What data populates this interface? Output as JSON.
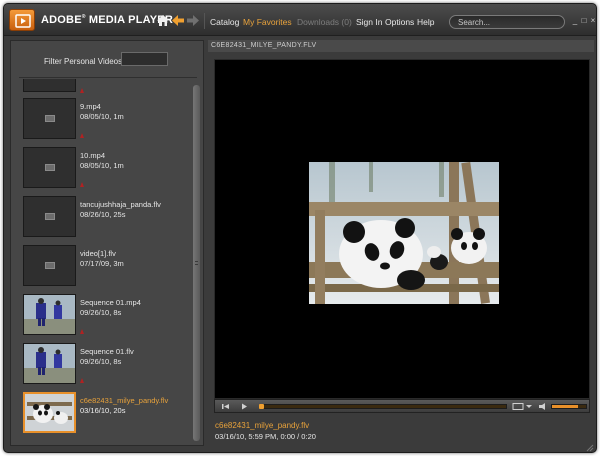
{
  "app": {
    "brand": "ADOBE",
    "brand_mark": "®",
    "brand_suffix": " MEDIA PLAYER"
  },
  "nav": {
    "home_icon": "home-icon",
    "back_icon": "back-arrow-icon",
    "forward_icon": "forward-arrow-icon"
  },
  "menu": {
    "catalog": "Catalog",
    "favorites": "My Favorites",
    "downloads": "Downloads (0)",
    "sign_in": "Sign In",
    "options": "Options",
    "help": "Help"
  },
  "search": {
    "placeholder": "Search..."
  },
  "window_controls": {
    "minimize": "_",
    "maximize": "□",
    "close": "×"
  },
  "sidebar": {
    "filter_label": "Filter Personal Videos",
    "filter_value": "",
    "items": [
      {
        "title": "9.mp4",
        "meta": "08/05/10, 1m",
        "thumb": "placeholder",
        "flag": true
      },
      {
        "title": "10.mp4",
        "meta": "08/05/10, 1m",
        "thumb": "placeholder",
        "flag": true
      },
      {
        "title": "tancujushhaja_panda.flv",
        "meta": "08/26/10, 25s",
        "thumb": "placeholder",
        "flag": false
      },
      {
        "title": "video[1].flv",
        "meta": "07/17/09, 3m",
        "thumb": "placeholder",
        "flag": false
      },
      {
        "title": "Sequence 01.mp4",
        "meta": "09/26/10, 8s",
        "thumb": "sequence",
        "flag": true
      },
      {
        "title": "Sequence 01.flv",
        "meta": "09/26/10, 8s",
        "thumb": "sequence",
        "flag": true
      },
      {
        "title": "c6e82431_milye_pandy.flv",
        "meta": "03/16/10, 20s",
        "thumb": "panda",
        "flag": false,
        "selected": true
      }
    ]
  },
  "player": {
    "header_title": "C6E82431_MILYE_PANDY.FLV",
    "now_title": "c6e82431_milye_pandy.flv",
    "now_meta": "03/16/10, 5:59 PM,  0:00 / 0:20",
    "progress": 0.0,
    "volume": 0.75
  },
  "colors": {
    "accent": "#e8a23b",
    "flag": "#b02222",
    "window_bg": "#3b3b3b"
  }
}
